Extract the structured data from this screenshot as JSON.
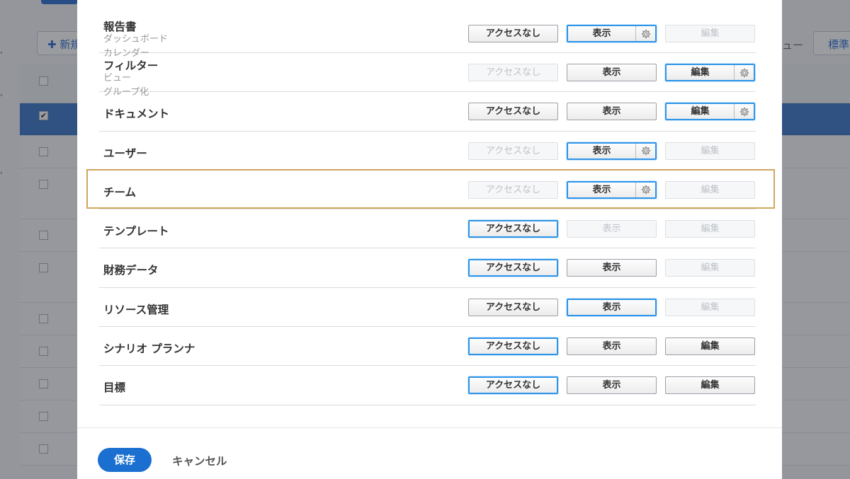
{
  "background": {
    "new_button_label": "✚ 新規",
    "right_text": "ュー",
    "standard_button_label": "標準"
  },
  "permissions": [
    {
      "name": "報告書",
      "subs": [
        "ダッシュボード",
        "カレンダー"
      ],
      "none": "アクセスなし",
      "view": "表示",
      "edit": "編集",
      "state": "view",
      "none_enabled": true,
      "view_enabled": true,
      "edit_enabled": false,
      "gear_on": "view"
    },
    {
      "name": "フィルター",
      "subs": [
        "ビュー",
        "グループ化"
      ],
      "none": "アクセスなし",
      "view": "表示",
      "edit": "編集",
      "state": "edit",
      "none_enabled": false,
      "view_enabled": true,
      "edit_enabled": true,
      "gear_on": "edit"
    },
    {
      "name": "ドキュメント",
      "subs": [],
      "none": "アクセスなし",
      "view": "表示",
      "edit": "編集",
      "state": "edit",
      "none_enabled": true,
      "view_enabled": true,
      "edit_enabled": true,
      "gear_on": "edit"
    },
    {
      "name": "ユーザー",
      "subs": [],
      "none": "アクセスなし",
      "view": "表示",
      "edit": "編集",
      "state": "view",
      "none_enabled": false,
      "view_enabled": true,
      "edit_enabled": false,
      "gear_on": "view"
    },
    {
      "name": "チーム",
      "subs": [],
      "none": "アクセスなし",
      "view": "表示",
      "edit": "編集",
      "state": "view",
      "none_enabled": false,
      "view_enabled": true,
      "edit_enabled": false,
      "gear_on": "view"
    },
    {
      "name": "テンプレート",
      "subs": [],
      "none": "アクセスなし",
      "view": "表示",
      "edit": "編集",
      "state": "none",
      "none_enabled": true,
      "view_enabled": false,
      "edit_enabled": false,
      "gear_on": ""
    },
    {
      "name": "財務データ",
      "subs": [],
      "none": "アクセスなし",
      "view": "表示",
      "edit": "編集",
      "state": "none",
      "none_enabled": true,
      "view_enabled": true,
      "edit_enabled": false,
      "gear_on": ""
    },
    {
      "name": "リソース管理",
      "subs": [],
      "none": "アクセスなし",
      "view": "表示",
      "edit": "編集",
      "state": "view",
      "none_enabled": true,
      "view_enabled": true,
      "edit_enabled": false,
      "gear_on": ""
    },
    {
      "name": "シナリオ プランナ",
      "subs": [],
      "none": "アクセスなし",
      "view": "表示",
      "edit": "編集",
      "state": "none",
      "none_enabled": true,
      "view_enabled": true,
      "edit_enabled": true,
      "gear_on": ""
    },
    {
      "name": "目標",
      "subs": [],
      "none": "アクセスなし",
      "view": "表示",
      "edit": "編集",
      "state": "none",
      "none_enabled": true,
      "view_enabled": true,
      "edit_enabled": true,
      "gear_on": ""
    }
  ],
  "footer": {
    "save_label": "保存",
    "cancel_label": "キャンセル"
  },
  "colors": {
    "accent": "#1a6fd0",
    "active_border": "#2f95e8",
    "highlight_border": "#d2a560"
  },
  "icons": {
    "gear": "gear-icon",
    "add": "plus-icon",
    "checkbox": "checkbox-icon"
  }
}
